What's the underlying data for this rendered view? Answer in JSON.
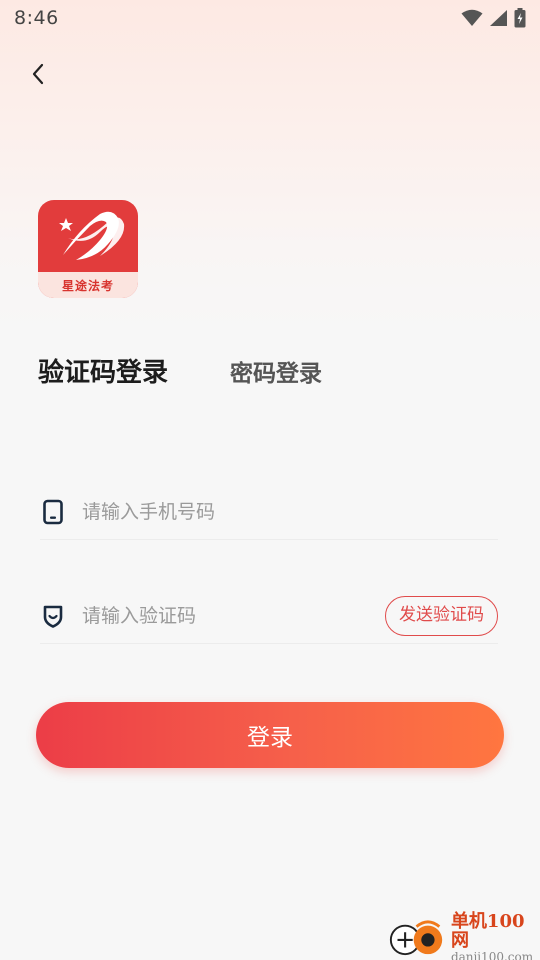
{
  "status_bar": {
    "time": "8:46",
    "icons": [
      "wifi-icon",
      "cell-signal-icon",
      "battery-charging-icon"
    ]
  },
  "nav": {
    "back_icon": "chevron-left-icon"
  },
  "logo": {
    "brand_text": "星途法考"
  },
  "tabs": [
    {
      "label": "验证码登录",
      "active": true
    },
    {
      "label": "密码登录",
      "active": false
    }
  ],
  "form": {
    "phone": {
      "placeholder": "请输入手机号码",
      "value": "",
      "icon": "phone-icon"
    },
    "code": {
      "placeholder": "请输入验证码",
      "value": "",
      "icon": "shield-icon"
    },
    "send_code_label": "发送验证码"
  },
  "login_label": "登录",
  "watermark": {
    "title": "单机100网",
    "url": "danji100.com"
  },
  "colors": {
    "accent": "#e04b4b",
    "gradient_start": "#ec3d47",
    "gradient_end": "#ff7640",
    "logo_red": "#e23c3c"
  }
}
